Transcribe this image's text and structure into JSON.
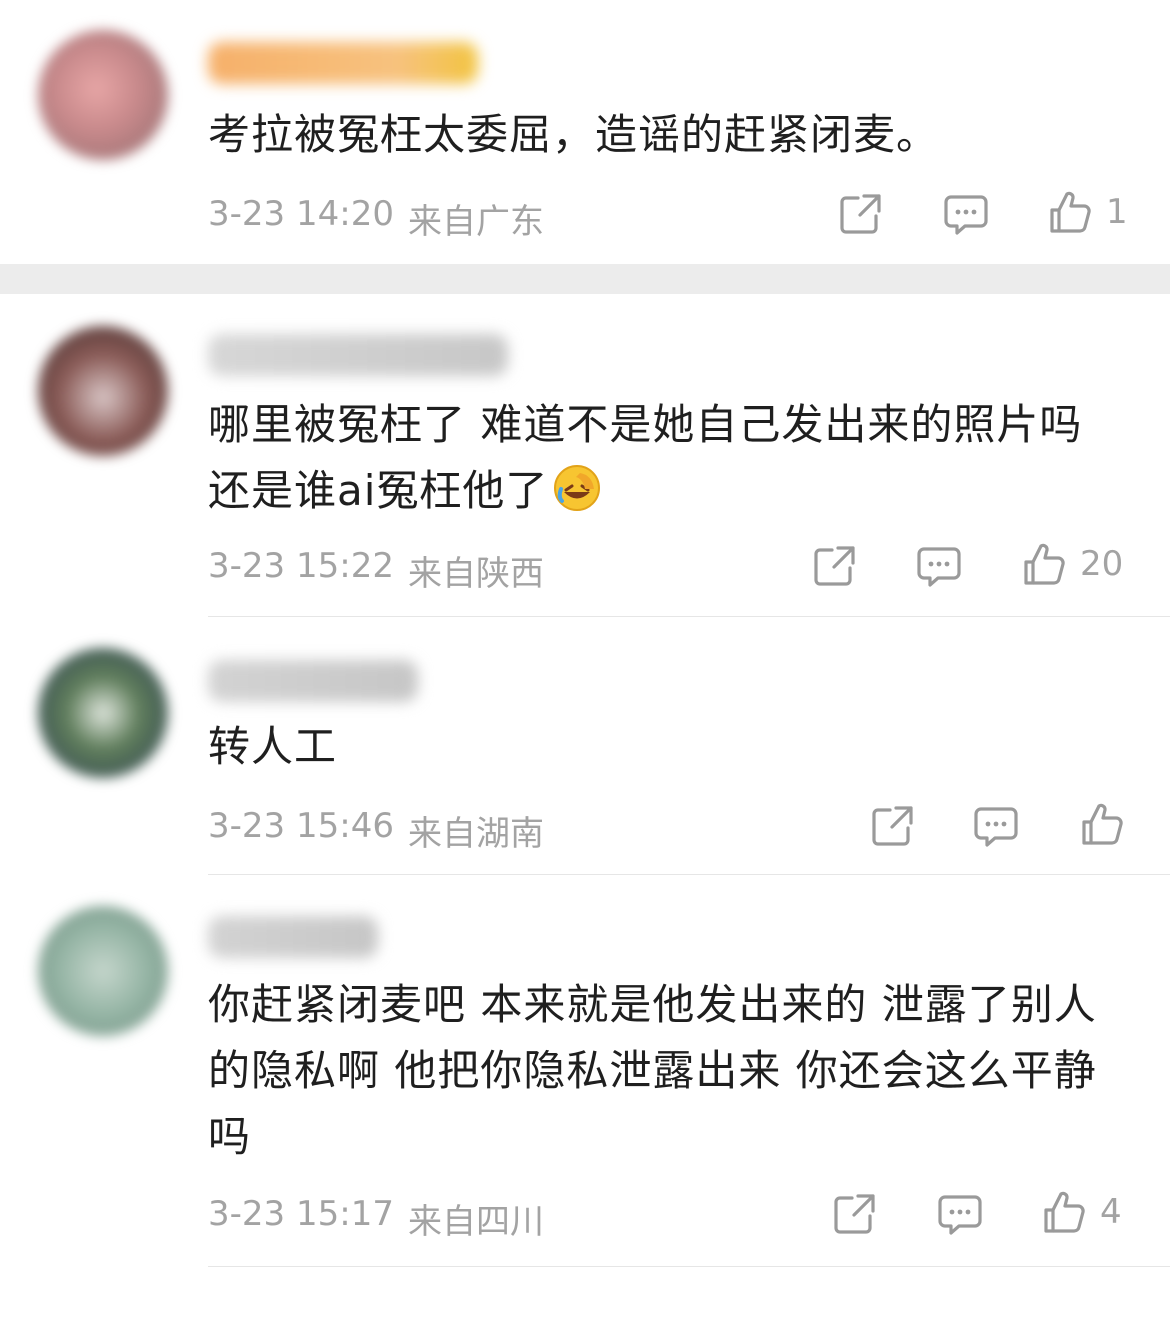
{
  "comments": [
    {
      "text": "考拉被冤枉太委屈，造谣的赶紧闭麦。",
      "date": "3-23 14:20",
      "location": "来自广东",
      "likes": "1"
    },
    {
      "text": "哪里被冤枉了 难道不是她自己发出来的照片吗 还是谁ai冤枉他了",
      "date": "3-23 15:22",
      "location": "来自陕西",
      "likes": "20"
    },
    {
      "text": "转人工",
      "date": "3-23 15:46",
      "location": "来自湖南",
      "likes": ""
    },
    {
      "text": "你赶紧闭麦吧 本来就是他发出来的 泄露了别人的隐私啊 他把你隐私泄露出来 你还会这么平静吗",
      "date": "3-23 15:17",
      "location": "来自四川",
      "likes": "4"
    }
  ],
  "icons": {
    "share": "share-icon",
    "comment": "comment-icon",
    "like": "thumbs-up-icon",
    "emoji": "rofl-emoji-icon"
  },
  "colors": {
    "text": "#1f1f1f",
    "meta": "#a3a3a3",
    "highlight_name": "#f5a04a"
  }
}
